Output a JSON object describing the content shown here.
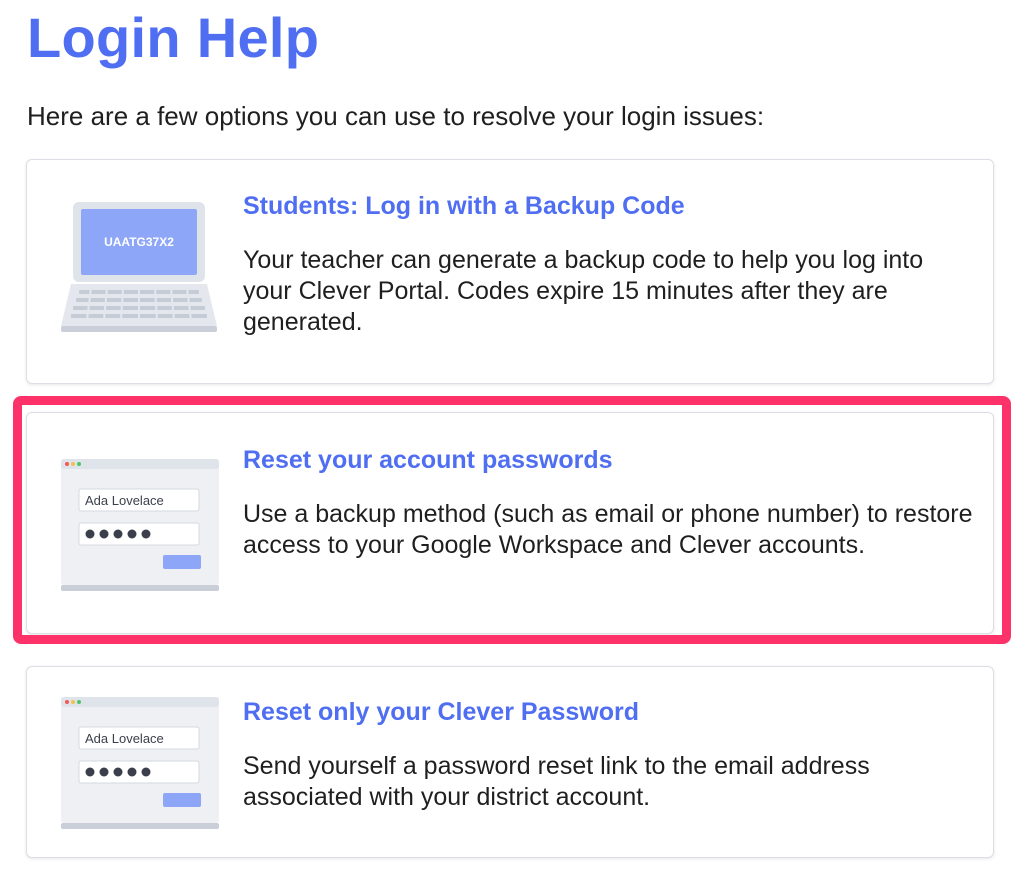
{
  "header": {
    "title": "Login Help",
    "intro": "Here are a few options you can use to resolve your login issues:"
  },
  "options": [
    {
      "title": "Students: Log in with a Backup Code",
      "description": "Your teacher can generate a backup code to help you log into your Clever Portal. Codes expire 15 minutes after they are generated.",
      "illustration": {
        "icon": "laptop-icon",
        "screen_code": "UAATG37X2"
      }
    },
    {
      "title": "Reset your account passwords",
      "description": "Use a backup method (such as email or phone number) to restore access to your Google Workspace and Clever accounts.",
      "highlighted": true,
      "illustration": {
        "icon": "login-window-icon",
        "username": "Ada Lovelace",
        "password_mask": "●●●●●"
      }
    },
    {
      "title": "Reset only your Clever Password",
      "description": "Send yourself a password reset link to the email address associated with your district account.",
      "illustration": {
        "icon": "login-window-icon",
        "username": "Ada Lovelace",
        "password_mask": "●●●●●"
      }
    }
  ],
  "colors": {
    "brand_blue": "#4f6ef2",
    "highlight": "#fd3269",
    "card_border": "#dcdfe6",
    "illustration_screen": "#8ea6f7",
    "illustration_gray": "#dfe3ea"
  }
}
